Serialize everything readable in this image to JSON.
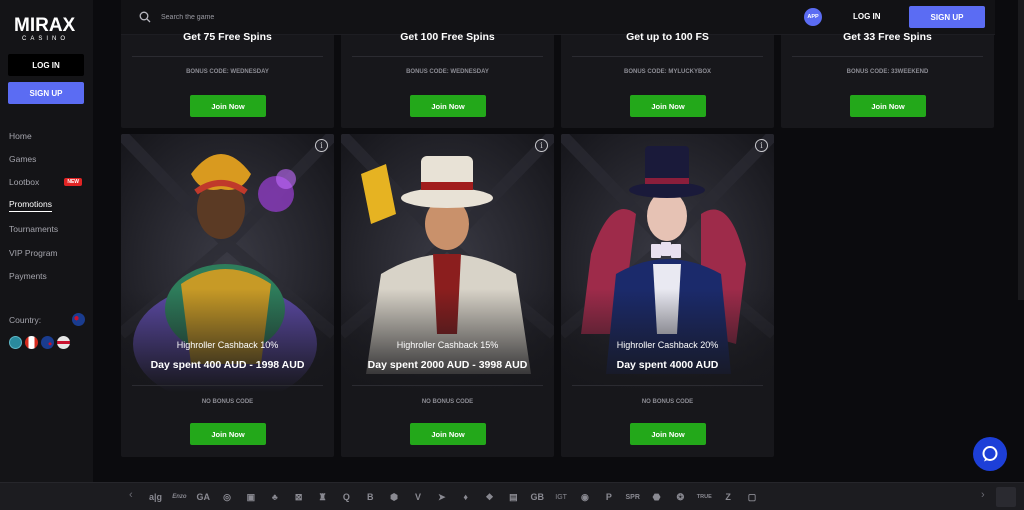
{
  "brand": {
    "logo_text": "MIRAX",
    "logo_sub": "CASINO"
  },
  "sidebar": {
    "login_label": "LOG IN",
    "signup_label": "SIGN UP",
    "items": [
      {
        "label": "Home",
        "active": false
      },
      {
        "label": "Games",
        "active": false
      },
      {
        "label": "Lootbox",
        "active": false,
        "badge": "NEW"
      },
      {
        "label": "Promotions",
        "active": true
      },
      {
        "label": "Tournaments",
        "active": false
      },
      {
        "label": "VIP Program",
        "active": false
      },
      {
        "label": "Payments",
        "active": false
      }
    ],
    "country_label": "Country:"
  },
  "header": {
    "search_placeholder": "Search the game",
    "app_label": "APP",
    "login_label": "LOG IN",
    "signup_label": "SIGN UP"
  },
  "promos_top": [
    {
      "title": "Get 75 Free Spins",
      "code": "BONUS CODE: WEDNESDAY",
      "button": "Join Now"
    },
    {
      "title": "Get 100 Free Spins",
      "code": "BONUS CODE: WEDNESDAY",
      "button": "Join Now"
    },
    {
      "title": "Get up to 100 FS",
      "code": "BONUS CODE: MYLUCKYBOX",
      "button": "Join Now"
    },
    {
      "title": "Get 33 Free Spins",
      "code": "BONUS CODE: 33WEEKEND",
      "button": "Join Now"
    }
  ],
  "promos_cashback": [
    {
      "subtitle": "Highroller Cashback 10%",
      "headline": "Day spent 400 AUD - 1998 AUD",
      "code": "NO BONUS CODE",
      "button": "Join Now",
      "art": "queen-character"
    },
    {
      "subtitle": "Highroller Cashback 15%",
      "headline": "Day spent 2000 AUD - 3998 AUD",
      "code": "NO BONUS CODE",
      "button": "Join Now",
      "art": "gambler-character"
    },
    {
      "subtitle": "Highroller Cashback 20%",
      "headline": "Day spent 4000 AUD",
      "code": "NO BONUS CODE",
      "button": "Join Now",
      "art": "magician-character"
    }
  ],
  "providers": {
    "prev": "‹",
    "next": "›",
    "items": [
      "a|g",
      "Enzo",
      "GA",
      "◎",
      "▣",
      "♣",
      "⊠",
      "♜",
      "Q",
      "B",
      "⬢",
      "V",
      "➤",
      "♦",
      "❖",
      "▤",
      "GB",
      "IGT",
      "◉",
      "P",
      "SPR",
      "⬣",
      "❂",
      "TRUE",
      "Z",
      "▢"
    ]
  },
  "colors": {
    "accent": "#5b6cf3",
    "join": "#23a81a",
    "badge_new": "#e02424",
    "chat": "#1d3fd8"
  }
}
